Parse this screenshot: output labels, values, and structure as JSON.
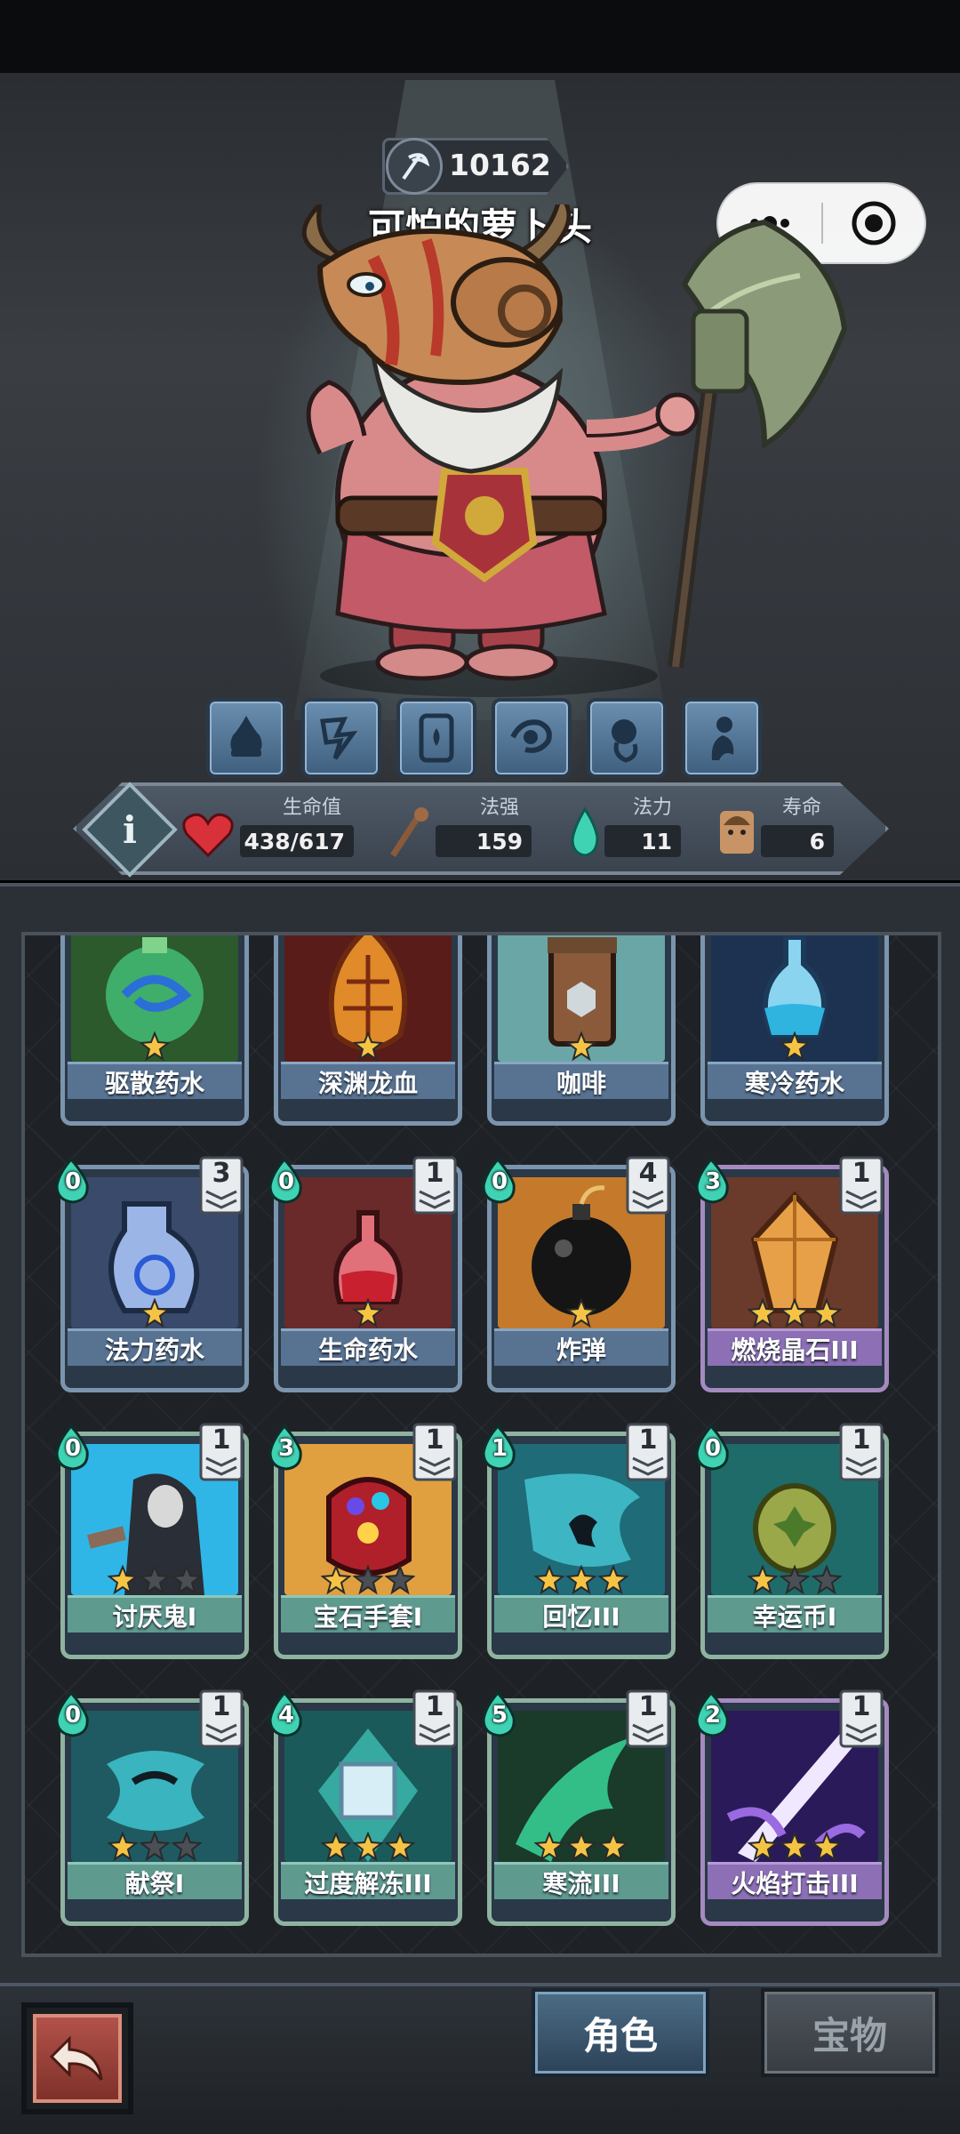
{
  "boss": {
    "score": "10162",
    "name": "可怕的萝卜头"
  },
  "stats": {
    "hp_label": "生命值",
    "hp_value": "438/617",
    "power_label": "法强",
    "power_value": "159",
    "mana_label": "法力",
    "mana_value": "11",
    "life_label": "寿命",
    "life_value": "6"
  },
  "abilities": [
    "fire-ability-icon",
    "lightning-ability-icon",
    "totem-ability-icon",
    "whirl-ability-icon",
    "spirit-ability-icon",
    "summon-ability-icon"
  ],
  "cards": [
    {
      "name": "驱散药水",
      "cost": "",
      "count": "",
      "stars": 1,
      "max_stars": 1,
      "rarity": "blue",
      "art": "swirl-potion"
    },
    {
      "name": "深渊龙血",
      "cost": "",
      "count": "",
      "stars": 1,
      "max_stars": 1,
      "rarity": "blue",
      "art": "dragon-blood"
    },
    {
      "name": "咖啡",
      "cost": "",
      "count": "",
      "stars": 1,
      "max_stars": 1,
      "rarity": "blue",
      "art": "coffee"
    },
    {
      "name": "寒冷药水",
      "cost": "",
      "count": "",
      "stars": 1,
      "max_stars": 1,
      "rarity": "blue",
      "art": "frost-potion"
    },
    {
      "name": "法力药水",
      "cost": "0",
      "count": "3",
      "stars": 1,
      "max_stars": 1,
      "rarity": "blue",
      "art": "mana-potion"
    },
    {
      "name": "生命药水",
      "cost": "0",
      "count": "1",
      "stars": 1,
      "max_stars": 1,
      "rarity": "blue",
      "art": "health-potion"
    },
    {
      "name": "炸弹",
      "cost": "0",
      "count": "4",
      "stars": 1,
      "max_stars": 1,
      "rarity": "blue",
      "art": "bomb"
    },
    {
      "name": "燃烧晶石III",
      "cost": "3",
      "count": "1",
      "stars": 3,
      "max_stars": 3,
      "rarity": "purple",
      "art": "crystal"
    },
    {
      "name": "讨厌鬼I",
      "cost": "0",
      "count": "1",
      "stars": 1,
      "max_stars": 3,
      "rarity": "green",
      "art": "hooded"
    },
    {
      "name": "宝石手套I",
      "cost": "3",
      "count": "1",
      "stars": 1,
      "max_stars": 3,
      "rarity": "green",
      "art": "gauntlet"
    },
    {
      "name": "回忆III",
      "cost": "1",
      "count": "1",
      "stars": 3,
      "max_stars": 3,
      "rarity": "green",
      "art": "memory"
    },
    {
      "name": "幸运币I",
      "cost": "0",
      "count": "1",
      "stars": 1,
      "max_stars": 3,
      "rarity": "green",
      "art": "coin"
    },
    {
      "name": "献祭I",
      "cost": "0",
      "count": "1",
      "stars": 1,
      "max_stars": 3,
      "rarity": "green",
      "art": "sacrifice"
    },
    {
      "name": "过度解冻III",
      "cost": "4",
      "count": "1",
      "stars": 3,
      "max_stars": 3,
      "rarity": "green",
      "art": "ice-cube"
    },
    {
      "name": "寒流III",
      "cost": "5",
      "count": "1",
      "stars": 3,
      "max_stars": 3,
      "rarity": "green",
      "art": "cold-wave"
    },
    {
      "name": "火焰打击III",
      "cost": "2",
      "count": "1",
      "stars": 3,
      "max_stars": 3,
      "rarity": "purple",
      "art": "flame-strike"
    }
  ],
  "tabs": {
    "character": "角色",
    "treasure": "宝物"
  },
  "colors": {
    "mana_green": "#3fd3b4",
    "star_gold": "#f6c445",
    "health_red": "#d8313a"
  }
}
